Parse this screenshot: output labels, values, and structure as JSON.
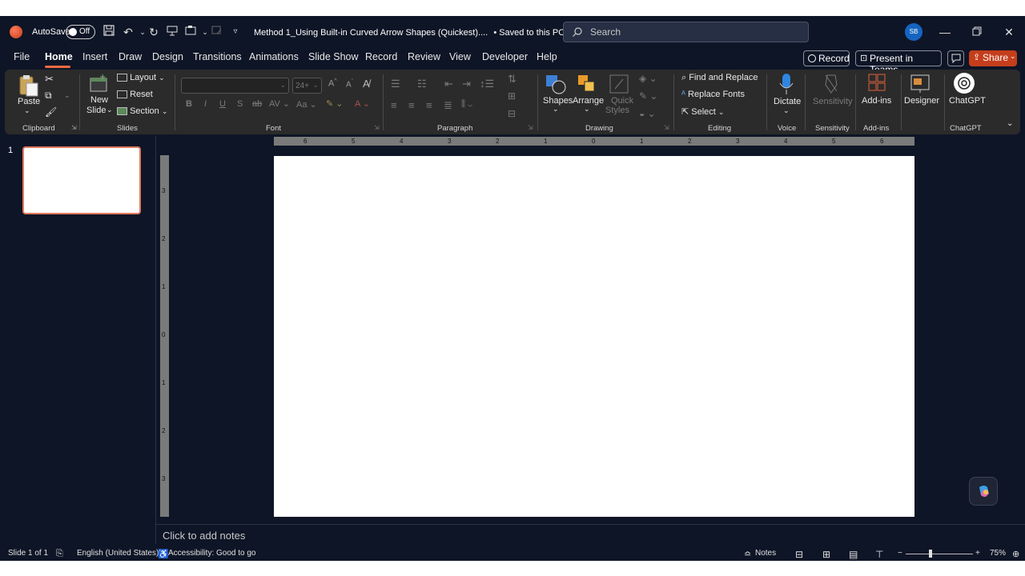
{
  "titlebar": {
    "autosave_label": "AutoSave",
    "autosave_state": "Off",
    "document_title": "Method 1_Using Built-in Curved Arrow Shapes (Quickest)....",
    "save_status": "• Saved to this PC",
    "search_placeholder": "Search",
    "user_initials": "SB"
  },
  "menu": {
    "tabs": [
      "File",
      "Home",
      "Insert",
      "Draw",
      "Design",
      "Transitions",
      "Animations",
      "Slide Show",
      "Record",
      "Review",
      "View",
      "Developer",
      "Help"
    ],
    "active_tab": "Home",
    "record_label": "Record",
    "present_label": "Present in Teams",
    "share_label": "Share"
  },
  "ribbon": {
    "clipboard": {
      "paste": "Paste",
      "group": "Clipboard"
    },
    "slides": {
      "new_slide_1": "New",
      "new_slide_2": "Slide",
      "layout": "Layout",
      "reset": "Reset",
      "section": "Section",
      "group": "Slides"
    },
    "font": {
      "font_size": "24+",
      "group": "Font",
      "bold": "B",
      "italic": "I",
      "underline": "U",
      "strike": "S"
    },
    "paragraph": {
      "group": "Paragraph"
    },
    "drawing": {
      "shapes": "Shapes",
      "arrange": "Arrange",
      "quick_styles_1": "Quick",
      "quick_styles_2": "Styles",
      "group": "Drawing"
    },
    "editing": {
      "find_replace": "Find and Replace",
      "replace_fonts": "Replace Fonts",
      "select": "Select",
      "group": "Editing"
    },
    "voice": {
      "dictate": "Dictate",
      "group": "Voice"
    },
    "sensitivity": {
      "label": "Sensitivity",
      "group": "Sensitivity"
    },
    "addins": {
      "label": "Add-ins",
      "group": "Add-ins"
    },
    "designer": {
      "label": "Designer"
    },
    "chatgpt": {
      "label": "ChatGPT",
      "group": "ChatGPT"
    }
  },
  "ruler": {
    "horizontal": [
      "6",
      "5",
      "4",
      "3",
      "2",
      "1",
      "0",
      "1",
      "2",
      "3",
      "4",
      "5",
      "6"
    ],
    "vertical": [
      "3",
      "2",
      "1",
      "0",
      "1",
      "2",
      "3"
    ]
  },
  "slides_panel": {
    "slide_number": "1"
  },
  "notes": {
    "placeholder": "Click to add notes"
  },
  "status": {
    "slide_info": "Slide 1 of 1",
    "language": "English (United States)",
    "accessibility": "Accessibility: Good to go",
    "notes_label": "Notes",
    "zoom": "75%"
  },
  "colors": {
    "accent": "#c43e1c",
    "background": "#0e1526",
    "ribbon": "#2b2b2b"
  }
}
